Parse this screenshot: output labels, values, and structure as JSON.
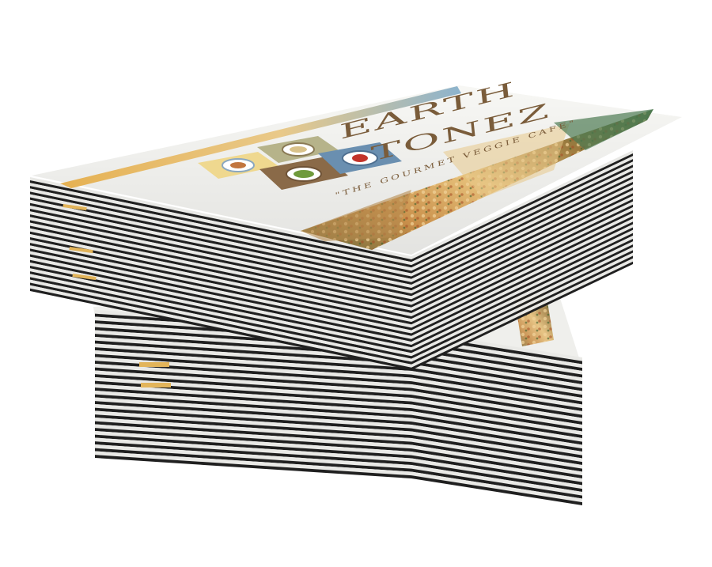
{
  "brand": {
    "name_line1": "EARTH",
    "name_line2": "TONEZ",
    "tagline": "\"THE GOURMET VEGGIE CAFE\""
  },
  "colors": {
    "card_face": "#f7f7f4",
    "card_edge_dark": "#202020",
    "card_edge_light": "#e9e9e6",
    "stripe_gold": "#e2b45a",
    "stripe_blue": "#8fb6cf",
    "brand_text": "#7a5c3a",
    "food_warm": "#c98f4a",
    "food_green": "#5f7d3e",
    "tile_yellow": "#efd88f",
    "tile_blue": "#6a8fb0",
    "tile_brown": "#8a6a48",
    "tile_olive": "#b6b38a"
  },
  "icons": [
    "soup-bowl-icon",
    "noodle-bowl-icon",
    "salad-bowl-icon",
    "tomato-plate-icon"
  ]
}
